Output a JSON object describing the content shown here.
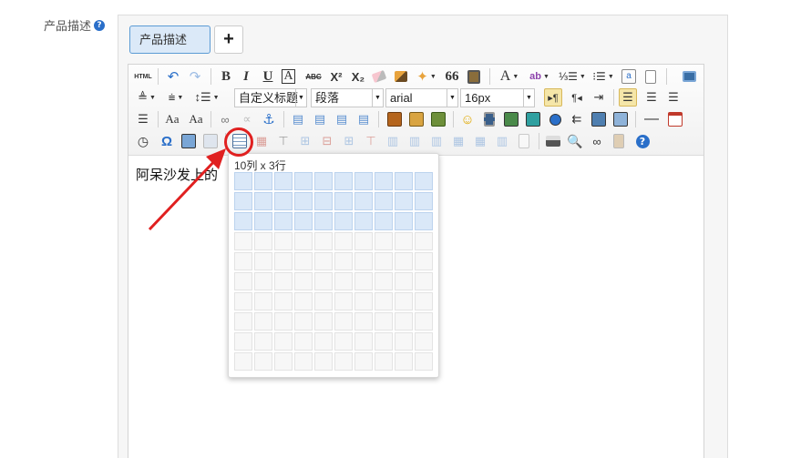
{
  "form": {
    "label": "产品描述",
    "help_icon": "question-circle-icon",
    "help_glyph": "?"
  },
  "tabs": [
    {
      "label": "产品描述",
      "active": true
    }
  ],
  "add_tab_label": "+",
  "toolbar": {
    "source_label": "HTML",
    "bold": "B",
    "italic": "I",
    "underline": "U",
    "border_letter": "A",
    "strike": "ABC",
    "superscript": "X²",
    "subscript": "X₂",
    "quote": "66",
    "fontcolor": "A",
    "rows_label": "☰",
    "paragraph_combo": "自定义标题",
    "format_combo": "段落",
    "font_combo": "arial",
    "size_combo": "16px",
    "special_char": "Ω",
    "help": "?"
  },
  "editor": {
    "content_text": "阿呆沙发上的"
  },
  "table_picker": {
    "caption": "10列 x 3行",
    "columns_selected": 10,
    "rows_selected": 3,
    "grid_columns": 10,
    "grid_rows": 10
  },
  "colors": {
    "accent": "#2a6fc9",
    "annotation": "#e02020",
    "selected_cell": "#dae8f8"
  }
}
